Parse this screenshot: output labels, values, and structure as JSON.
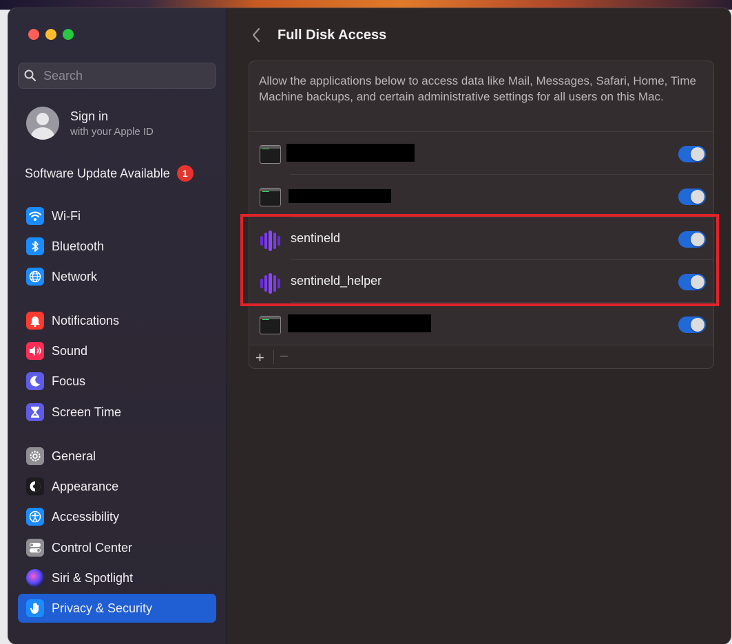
{
  "window": {
    "title": "Full Disk Access"
  },
  "sidebar": {
    "search_placeholder": "Search",
    "account": {
      "title": "Sign in",
      "subtitle": "with your Apple ID"
    },
    "update": {
      "label": "Software Update Available",
      "badge": "1"
    },
    "items": [
      {
        "label": "Wi-Fi",
        "icon": "wifi-icon",
        "color": "#1a8cff"
      },
      {
        "label": "Bluetooth",
        "icon": "bluetooth-icon",
        "color": "#1a8cff"
      },
      {
        "label": "Network",
        "icon": "globe-icon",
        "color": "#1a8cff"
      },
      {
        "label": "Notifications",
        "icon": "bell-icon",
        "color": "#ff3b30"
      },
      {
        "label": "Sound",
        "icon": "speaker-icon",
        "color": "#ff2d55"
      },
      {
        "label": "Focus",
        "icon": "moon-icon",
        "color": "#5e5ce6"
      },
      {
        "label": "Screen Time",
        "icon": "hourglass-icon",
        "color": "#5e5ce6"
      },
      {
        "label": "General",
        "icon": "gear-icon",
        "color": "#8e8e93"
      },
      {
        "label": "Appearance",
        "icon": "appearance-icon",
        "color": "#1c1c1e"
      },
      {
        "label": "Accessibility",
        "icon": "accessibility-icon",
        "color": "#1a8cff"
      },
      {
        "label": "Control Center",
        "icon": "control-center-icon",
        "color": "#8e8e93"
      },
      {
        "label": "Siri & Spotlight",
        "icon": "siri-icon",
        "color": "#2b2b5a"
      },
      {
        "label": "Privacy & Security",
        "icon": "hand-icon",
        "color": "#1a8cff",
        "selected": true
      }
    ]
  },
  "main": {
    "description": "Allow the applications below to access data like Mail, Messages, Safari, Home, Time Machine backups, and certain administrative settings for all users on this Mac.",
    "apps": [
      {
        "name": "",
        "icon": "terminal-icon",
        "redacted": true,
        "enabled": true
      },
      {
        "name": "",
        "icon": "terminal-icon",
        "redacted": true,
        "enabled": true
      },
      {
        "name": "sentineld",
        "icon": "sentinelone-icon",
        "redacted": false,
        "enabled": true
      },
      {
        "name": "sentineld_helper",
        "icon": "sentinelone-icon",
        "redacted": false,
        "enabled": true
      },
      {
        "name": "",
        "icon": "terminal-icon",
        "redacted": true,
        "enabled": true
      }
    ],
    "footer": {
      "add_label": "+",
      "remove_label": "−"
    },
    "highlight_color": "#e0232b",
    "accent": "#2169d8"
  }
}
